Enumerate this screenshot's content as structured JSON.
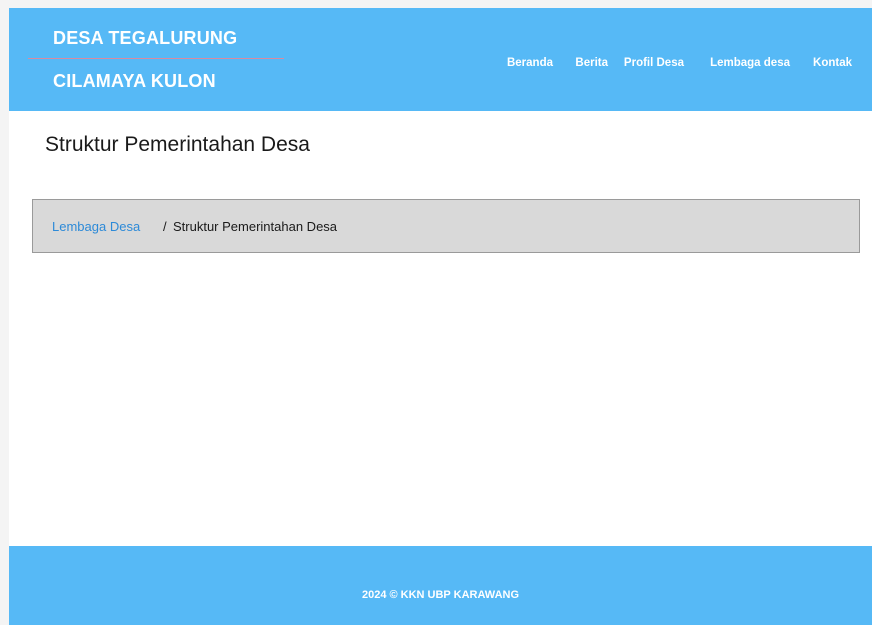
{
  "header": {
    "brand_line1": "DESA TEGALURUNG",
    "brand_line2": "CILAMAYA KULON",
    "nav": [
      {
        "label": "Beranda"
      },
      {
        "label": "Berita"
      },
      {
        "label": "Profil Desa"
      },
      {
        "label": "Lembaga desa"
      },
      {
        "label": "Kontak"
      }
    ]
  },
  "main": {
    "page_title": "Struktur Pemerintahan Desa",
    "breadcrumb": {
      "parent": "Lembaga Desa",
      "separator": "/",
      "current": "Struktur Pemerintahan Desa"
    }
  },
  "footer": {
    "text": "2024  © KKN UBP KARAWANG"
  },
  "colors": {
    "header_bg": "#56b9f6",
    "footer_bg": "#56b9f6",
    "breadcrumb_bg": "#d9d9d9",
    "link": "#2d8ad8"
  }
}
